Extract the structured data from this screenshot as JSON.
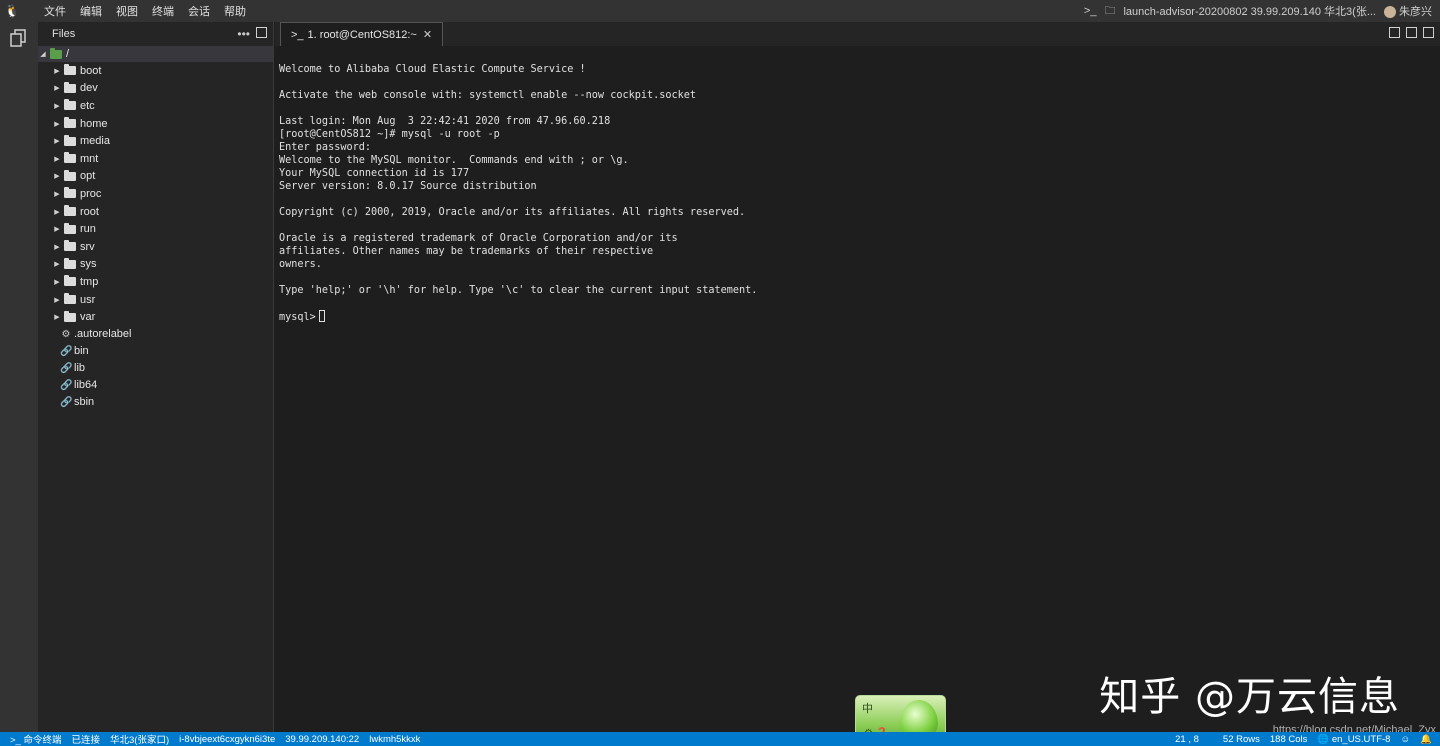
{
  "app": {
    "logo_icon": "tux-icon",
    "menus": [
      "文件",
      "编辑",
      "视图",
      "终端",
      "会话",
      "帮助"
    ],
    "session_title": "launch-advisor-20200802 39.99.209.140 华北3(张...",
    "user_name": "朱彦兴"
  },
  "sidebar": {
    "title": "Files",
    "root_label": "/",
    "folders": [
      "boot",
      "dev",
      "etc",
      "home",
      "media",
      "mnt",
      "opt",
      "proc",
      "root",
      "run",
      "srv",
      "sys",
      "tmp",
      "usr",
      "var"
    ],
    "files": [
      {
        "name": ".autorelabel",
        "icon": "gear-icon"
      },
      {
        "name": "bin",
        "icon": "link-icon"
      },
      {
        "name": "lib",
        "icon": "link-icon"
      },
      {
        "name": "lib64",
        "icon": "link-icon"
      },
      {
        "name": "sbin",
        "icon": "link-icon"
      }
    ]
  },
  "tabs": [
    {
      "label": "1. root@CentOS812:~"
    }
  ],
  "terminal": {
    "lines": [
      "Welcome to Alibaba Cloud Elastic Compute Service !",
      "",
      "Activate the web console with: systemctl enable --now cockpit.socket",
      "",
      "Last login: Mon Aug  3 22:42:41 2020 from 47.96.60.218",
      "[root@CentOS812 ~]# mysql -u root -p",
      "Enter password:",
      "Welcome to the MySQL monitor.  Commands end with ; or \\g.",
      "Your MySQL connection id is 177",
      "Server version: 8.0.17 Source distribution",
      "",
      "Copyright (c) 2000, 2019, Oracle and/or its affiliates. All rights reserved.",
      "",
      "Oracle is a registered trademark of Oracle Corporation and/or its",
      "affiliates. Other names may be trademarks of their respective",
      "owners.",
      "",
      "Type 'help;' or '\\h' for help. Type '\\c' to clear the current input statement.",
      ""
    ],
    "prompt": "mysql>"
  },
  "watermark": {
    "text": "知乎 @万云信息",
    "url": "https://blog.csdn.net/Michael_Zyx"
  },
  "ime": {
    "label": "中"
  },
  "statusbar": {
    "command_terminal": "命令终端",
    "connected": "已连接",
    "region": "华北3(张家口)",
    "instance_id": "i-8vbjeext6cxgykn6i3te",
    "ip": "39.99.209.140:22",
    "key": "lwkmh5kkxk",
    "cursor_pos": "21 , 8",
    "rows": "52 Rows",
    "cols": "188 Cols",
    "encoding": "en_US.UTF-8"
  }
}
